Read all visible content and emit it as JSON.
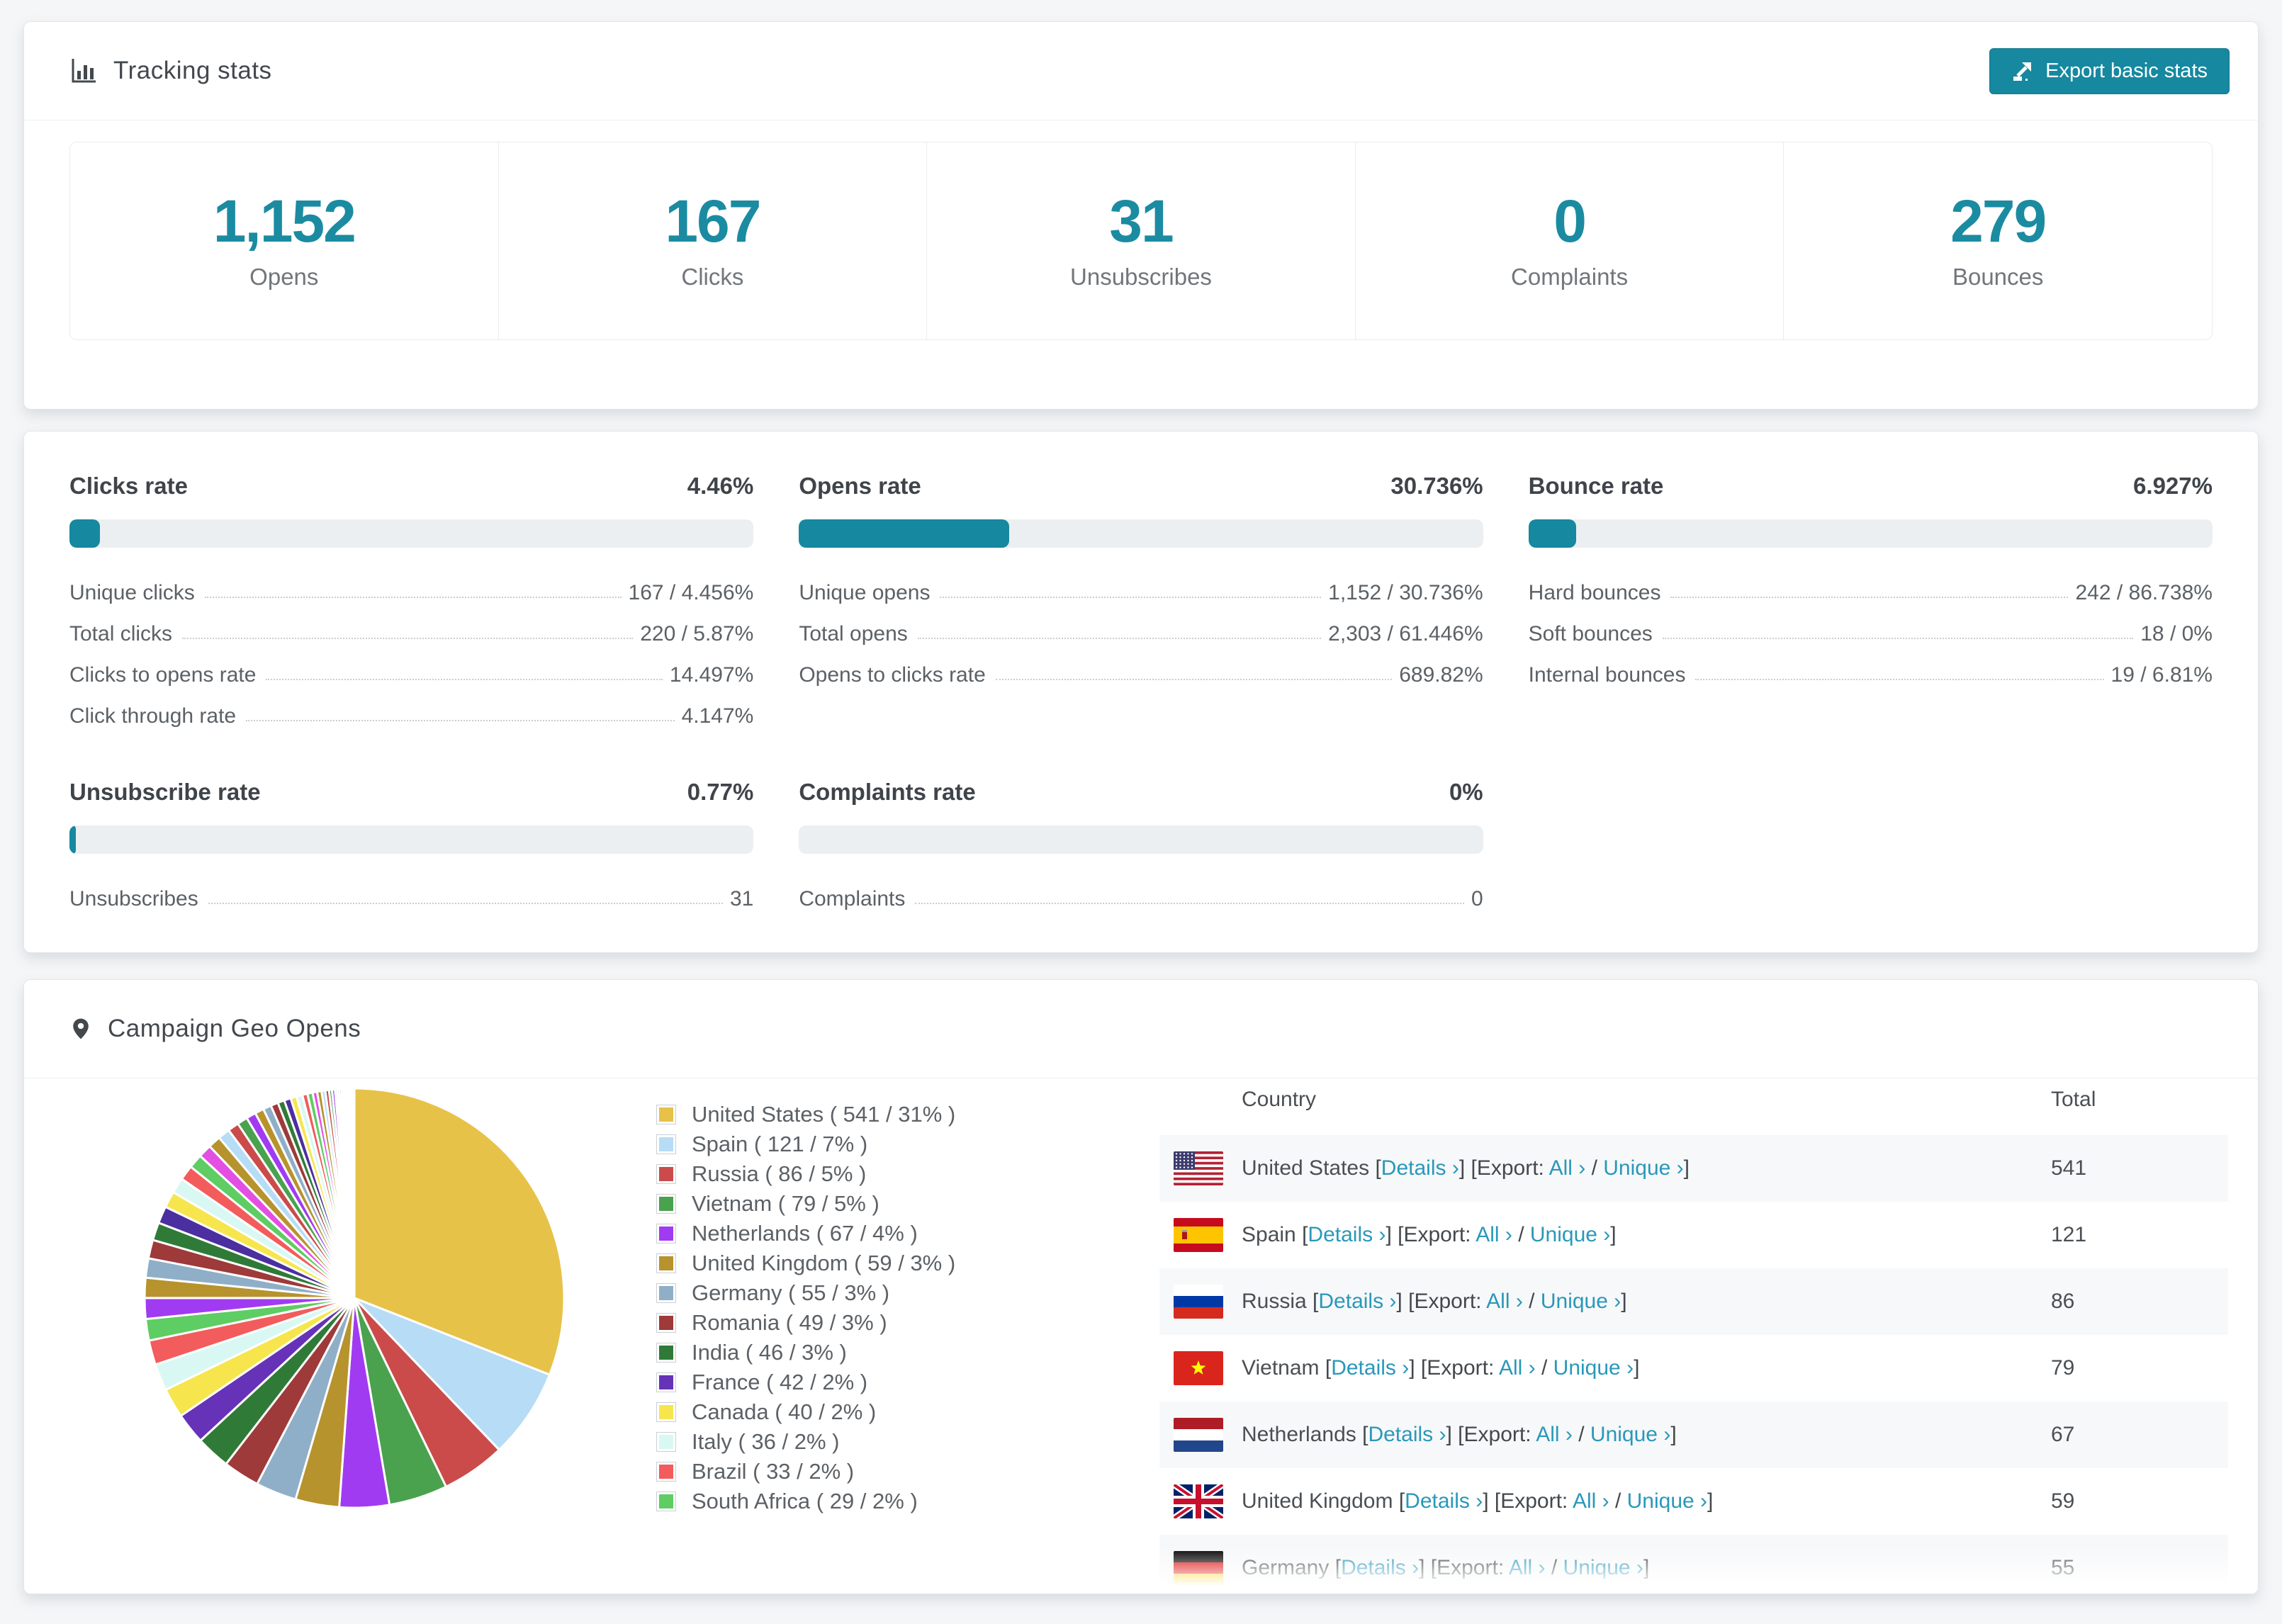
{
  "accent_color": "#16889f",
  "link_color": "#2998ba",
  "tracking": {
    "title": "Tracking stats",
    "export_label": "Export basic stats",
    "stats": [
      {
        "value": "1,152",
        "label": "Opens"
      },
      {
        "value": "167",
        "label": "Clicks"
      },
      {
        "value": "31",
        "label": "Unsubscribes"
      },
      {
        "value": "0",
        "label": "Complaints"
      },
      {
        "value": "279",
        "label": "Bounces"
      }
    ]
  },
  "rates": {
    "panels": [
      {
        "title": "Clicks rate",
        "value": "4.46%",
        "bar_pct": 4.46,
        "rows": [
          {
            "label": "Unique clicks",
            "value": "167 / 4.456%"
          },
          {
            "label": "Total clicks",
            "value": "220 / 5.87%"
          },
          {
            "label": "Clicks to opens rate",
            "value": "14.497%"
          },
          {
            "label": "Click through rate",
            "value": "4.147%"
          }
        ]
      },
      {
        "title": "Opens rate",
        "value": "30.736%",
        "bar_pct": 30.736,
        "rows": [
          {
            "label": "Unique opens",
            "value": "1,152 / 30.736%"
          },
          {
            "label": "Total opens",
            "value": "2,303 / 61.446%"
          },
          {
            "label": "Opens to clicks rate",
            "value": "689.82%"
          }
        ]
      },
      {
        "title": "Bounce rate",
        "value": "6.927%",
        "bar_pct": 6.927,
        "rows": [
          {
            "label": "Hard bounces",
            "value": "242 / 86.738%"
          },
          {
            "label": "Soft bounces",
            "value": "18 / 0%"
          },
          {
            "label": "Internal bounces",
            "value": "19 / 6.81%"
          }
        ]
      },
      {
        "title": "Unsubscribe rate",
        "value": "0.77%",
        "bar_pct": 0.77,
        "rows": [
          {
            "label": "Unsubscribes",
            "value": "31"
          }
        ]
      },
      {
        "title": "Complaints rate",
        "value": "0%",
        "bar_pct": 0,
        "rows": [
          {
            "label": "Complaints",
            "value": "0"
          }
        ]
      }
    ]
  },
  "geo": {
    "title": "Campaign Geo Opens",
    "table": {
      "col_country": "Country",
      "col_total": "Total",
      "details_label": "Details ›",
      "export_prefix": "[Export:",
      "all_label": "All ›",
      "unique_label": "Unique ›",
      "rows": [
        {
          "country": "United States",
          "flag": "us",
          "total": "541"
        },
        {
          "country": "Spain",
          "flag": "es",
          "total": "121"
        },
        {
          "country": "Russia",
          "flag": "ru",
          "total": "86"
        },
        {
          "country": "Vietnam",
          "flag": "vn",
          "total": "79"
        },
        {
          "country": "Netherlands",
          "flag": "nl",
          "total": "67"
        },
        {
          "country": "United Kingdom",
          "flag": "gb",
          "total": "59"
        },
        {
          "country": "Germany",
          "flag": "de",
          "total": "55"
        }
      ]
    }
  },
  "chart_data": {
    "type": "pie",
    "title": "Campaign Geo Opens",
    "legend_position": "right",
    "start_angle": "top, clockwise",
    "slices": [
      {
        "name": "United States",
        "value": 541,
        "pct": 31,
        "color": "#e7c248",
        "label": "United States ( 541 / 31% )"
      },
      {
        "name": "Spain",
        "value": 121,
        "pct": 7,
        "color": "#b7dcf5",
        "label": "Spain ( 121 / 7% )"
      },
      {
        "name": "Russia",
        "value": 86,
        "pct": 5,
        "color": "#cb4b4b",
        "label": "Russia ( 86 / 5% )"
      },
      {
        "name": "Vietnam",
        "value": 79,
        "pct": 5,
        "color": "#4aa24f",
        "label": "Vietnam ( 79 / 5% )"
      },
      {
        "name": "Netherlands",
        "value": 67,
        "pct": 4,
        "color": "#a13bf2",
        "label": "Netherlands ( 67 / 4% )"
      },
      {
        "name": "United Kingdom",
        "value": 59,
        "pct": 3,
        "color": "#b6932c",
        "label": "United Kingdom ( 59 / 3% )"
      },
      {
        "name": "Germany",
        "value": 55,
        "pct": 3,
        "color": "#8fafc8",
        "label": "Germany ( 55 / 3% )"
      },
      {
        "name": "Romania",
        "value": 49,
        "pct": 3,
        "color": "#9e3a3a",
        "label": "Romania ( 49 / 3% )"
      },
      {
        "name": "India",
        "value": 46,
        "pct": 3,
        "color": "#307a38",
        "label": "India ( 46 / 3% )"
      },
      {
        "name": "France",
        "value": 42,
        "pct": 2,
        "color": "#6632b8",
        "label": "France ( 42 / 2% )"
      },
      {
        "name": "Canada",
        "value": 40,
        "pct": 2,
        "color": "#f7e54d",
        "label": "Canada ( 40 / 2% )"
      },
      {
        "name": "Italy",
        "value": 36,
        "pct": 2,
        "color": "#d9f8f3",
        "label": "Italy ( 36 / 2% )"
      },
      {
        "name": "Brazil",
        "value": 33,
        "pct": 2,
        "color": "#f25c5c",
        "label": "Brazil ( 33 / 2% )"
      },
      {
        "name": "South Africa",
        "value": 29,
        "pct": 2,
        "color": "#5ecd63",
        "label": "South Africa ( 29 / 2% )"
      }
    ],
    "others_estimated": [
      28,
      27,
      26,
      25,
      24,
      23,
      22,
      21,
      20,
      19,
      18,
      17,
      16,
      15,
      14,
      13,
      12,
      11,
      10,
      9,
      9,
      8,
      8,
      7,
      7,
      6,
      6,
      5,
      5,
      4,
      4,
      3,
      3,
      3,
      2,
      2,
      2,
      2,
      1,
      1,
      1,
      1,
      1,
      1,
      0.8,
      0.6,
      0.5,
      0.4,
      0.3,
      0.2
    ],
    "palette_cycle": [
      "#a13bf2",
      "#b6932c",
      "#8fafc8",
      "#9e3a3a",
      "#307a38",
      "#4b2fa0",
      "#f7e54d",
      "#d9f8f3",
      "#f25c5c",
      "#5ecd63",
      "#e24fe2",
      "#b6932c",
      "#b7dcf5",
      "#cb4b4b",
      "#4aa24f"
    ]
  }
}
